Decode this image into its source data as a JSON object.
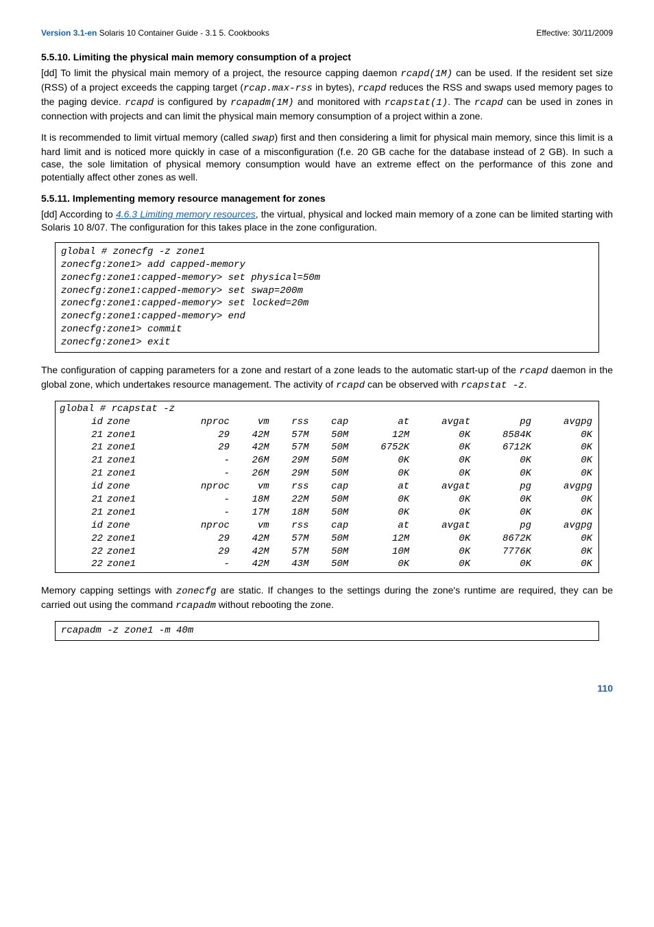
{
  "header": {
    "version": "Version 3.1-en",
    "mid": " Solaris 10 Container Guide - 3.1  5. Cookbooks",
    "effective": "Effective: 30/11/2009"
  },
  "sec1": {
    "title": "5.5.10. Limiting the physical main memory consumption of a project",
    "p1a": "[dd] To limit the physical main memory of a project, the resource capping daemon ",
    "rcapd1m": "rcapd(1M)",
    "p1b": " can be used. If the resident set size (RSS) of a project exceeds the capping target (",
    "rcapmax": "rcap.max-rss",
    "p1c": " in bytes), ",
    "rcapd": "rcapd",
    "p1d": " reduces the RSS and swaps used memory pages to the paging device. ",
    "p1e": " is configured by ",
    "rcapadm1m": "rcapadm(1M)",
    "p1f": " and monitored with ",
    "rcapstat1": "rcapstat(1)",
    "p1g": ". The ",
    "p1h": " can be used in zones in connection with projects and can limit the physical main memory consumption of a project within a zone.",
    "p2a": "It is recommended to limit virtual memory (called ",
    "swap": "swap",
    "p2b": ") first and then considering a limit for physical main memory, since this limit is a hard limit and is noticed more quickly in case of a  misconfiguration (f.e. 20 GB cache for the database instead of 2 GB). In such a case, the sole limitation of physical memory consumption would have an extreme effect on the performance of this zone and potentially affect other zones as well."
  },
  "sec2": {
    "title": "5.5.11. Implementing memory resource management for zones",
    "p1a": "[dd] According to ",
    "link": "4.6.3 Limiting memory resources",
    "p1b": ", the virtual, physical and locked main memory of a zone can be limited starting with Solaris 10 8/07. The configuration for this takes place in the zone configuration."
  },
  "code1": "global # zonecfg -z zone1\nzonecfg:zone1> add capped-memory\nzonecfg:zone1:capped-memory> set physical=50m\nzonecfg:zone1:capped-memory> set swap=200m\nzonecfg:zone1:capped-memory> set locked=20m\nzonecfg:zone1:capped-memory> end\nzonecfg:zone1> commit\nzonecfg:zone1> exit",
  "mid": {
    "p1a": "The configuration of capping parameters for a zone and restart of a zone leads to the automatic start-up of the ",
    "rcapd": "rcapd",
    "p1b": " daemon in the global zone, which undertakes resource management. The activity of ",
    "p1c": " can be observed with ",
    "rcapstatz": "rcapstat -z",
    "p1d": "."
  },
  "rcap_head": "global # rcapstat -z",
  "rcap_rows": [
    [
      "id",
      "zone",
      "nproc",
      "vm",
      "rss",
      "cap",
      "at",
      "avgat",
      "pg",
      "avgpg"
    ],
    [
      "21",
      "zone1",
      "29",
      "42M",
      "57M",
      "50M",
      "12M",
      "0K",
      "8584K",
      "0K"
    ],
    [
      "21",
      "zone1",
      "29",
      "42M",
      "57M",
      "50M",
      "6752K",
      "0K",
      "6712K",
      "0K"
    ],
    [
      "21",
      "zone1",
      "-",
      "26M",
      "29M",
      "50M",
      "0K",
      "0K",
      "0K",
      "0K"
    ],
    [
      "21",
      "zone1",
      "-",
      "26M",
      "29M",
      "50M",
      "0K",
      "0K",
      "0K",
      "0K"
    ],
    [
      "id",
      "zone",
      "nproc",
      "vm",
      "rss",
      "cap",
      "at",
      "avgat",
      "pg",
      "avgpg"
    ],
    [
      "21",
      "zone1",
      "-",
      "18M",
      "22M",
      "50M",
      "0K",
      "0K",
      "0K",
      "0K"
    ],
    [
      "21",
      "zone1",
      "-",
      "17M",
      "18M",
      "50M",
      "0K",
      "0K",
      "0K",
      "0K"
    ],
    [
      "id",
      "zone",
      "nproc",
      "vm",
      "rss",
      "cap",
      "at",
      "avgat",
      "pg",
      "avgpg"
    ],
    [
      "22",
      "zone1",
      "29",
      "42M",
      "57M",
      "50M",
      "12M",
      "0K",
      "8672K",
      "0K"
    ],
    [
      "22",
      "zone1",
      "29",
      "42M",
      "57M",
      "50M",
      "10M",
      "0K",
      "7776K",
      "0K"
    ],
    [
      "22",
      "zone1",
      "-",
      "42M",
      "43M",
      "50M",
      "0K",
      "0K",
      "0K",
      "0K"
    ]
  ],
  "after": {
    "p1a": "Memory capping settings with ",
    "zonecfg": "zonecfg",
    "p1b": " are static. If changes to the settings during the zone's runtime are required, they can be carried out using the command ",
    "rcapadm": "rcapadm",
    "p1c": " without rebooting the zone."
  },
  "code2": "rcapadm -z zone1 -m 40m",
  "pagenum": "110"
}
